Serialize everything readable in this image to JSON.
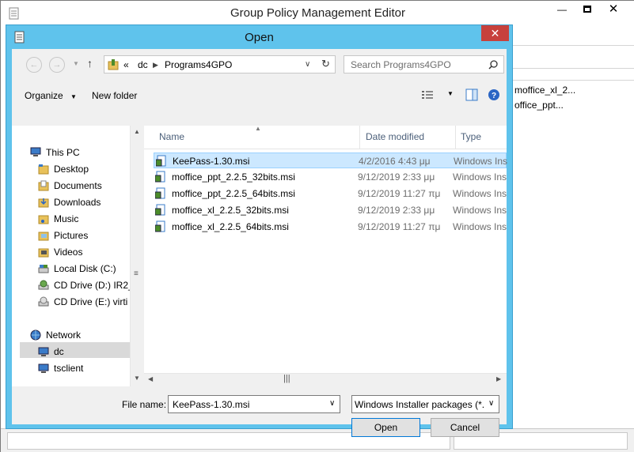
{
  "background_window": {
    "title": "Group Policy Management Editor",
    "files": [
      "moffice_xl_2...",
      "office_ppt..."
    ]
  },
  "dialog": {
    "title": "Open",
    "breadcrumb": [
      "«",
      "dc",
      "Programs4GPO"
    ],
    "search_placeholder": "Search Programs4GPO",
    "toolbar": {
      "organize": "Organize",
      "new_folder": "New folder"
    },
    "nav": {
      "items": [
        {
          "label": "This PC",
          "icon": "computer-icon"
        },
        {
          "label": "Desktop",
          "icon": "folder-icon"
        },
        {
          "label": "Documents",
          "icon": "folder-icon"
        },
        {
          "label": "Downloads",
          "icon": "folder-icon"
        },
        {
          "label": "Music",
          "icon": "folder-icon"
        },
        {
          "label": "Pictures",
          "icon": "folder-icon"
        },
        {
          "label": "Videos",
          "icon": "folder-icon"
        },
        {
          "label": "Local Disk (C:)",
          "icon": "drive-icon"
        },
        {
          "label": "CD Drive (D:) IR2_",
          "icon": "cd-drive-icon"
        },
        {
          "label": "CD Drive (E:) virti",
          "icon": "cd-drive-icon"
        },
        {
          "label": "Network",
          "icon": "network-icon"
        },
        {
          "label": "dc",
          "icon": "network-computer-icon"
        },
        {
          "label": "tsclient",
          "icon": "network-computer-icon"
        }
      ]
    },
    "columns": {
      "name": "Name",
      "date": "Date modified",
      "type": "Type"
    },
    "files": [
      {
        "name": "KeePass-1.30.msi",
        "date": "4/2/2016 4:43 μμ",
        "type": "Windows Insta"
      },
      {
        "name": "moffice_ppt_2.2.5_32bits.msi",
        "date": "9/12/2019 2:33 μμ",
        "type": "Windows Insta"
      },
      {
        "name": "moffice_ppt_2.2.5_64bits.msi",
        "date": "9/12/2019 11:27 πμ",
        "type": "Windows Insta"
      },
      {
        "name": "moffice_xl_2.2.5_32bits.msi",
        "date": "9/12/2019 2:33 μμ",
        "type": "Windows Insta"
      },
      {
        "name": "moffice_xl_2.2.5_64bits.msi",
        "date": "9/12/2019 11:27 πμ",
        "type": "Windows Insta"
      }
    ],
    "file_name_label": "File name:",
    "file_name_value": "KeePass-1.30.msi",
    "file_type_value": "Windows Installer packages (*.r",
    "open_label": "Open",
    "cancel_label": "Cancel"
  }
}
